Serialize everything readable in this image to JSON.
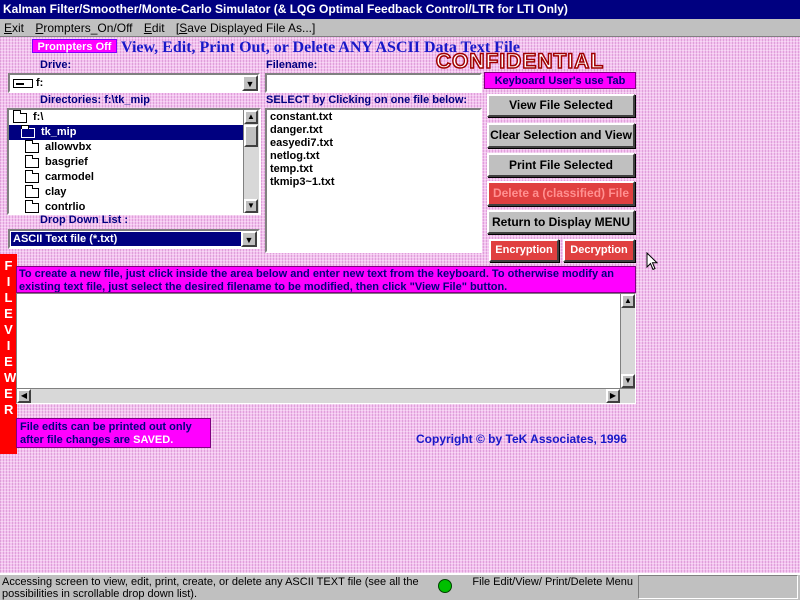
{
  "window": {
    "title": "Kalman Filter/Smoother/Monte-Carlo Simulator (& LQG Optimal Feedback Control/LTR for LTI Only)"
  },
  "menu": {
    "items": [
      "Exit",
      "Prompters_On/Off",
      "Edit",
      "[Save Displayed File As...]"
    ]
  },
  "header": {
    "prompters_badge": "Prompters Off",
    "heading": "View, Edit, Print Out, or Delete ANY ASCII Data Text File",
    "stamp": "CONFIDENTIAL"
  },
  "drive": {
    "label": "Drive:",
    "value": "f:"
  },
  "directories": {
    "label": "Directories: f:\\tk_mip",
    "items": [
      "f:\\",
      "tk_mip",
      "allowvbx",
      "basgrief",
      "carmodel",
      "clay",
      "contrlio"
    ],
    "selected_index": 1
  },
  "filetype": {
    "label": "Drop Down List :",
    "value": "ASCII Text file (*.txt)"
  },
  "filename": {
    "label": "Filename:",
    "value": ""
  },
  "files": {
    "label": "SELECT by Clicking on one file below:",
    "items": [
      "constant.txt",
      "danger.txt",
      "easyedi7.txt",
      "netlog.txt",
      "temp.txt",
      "tkmip3~1.txt"
    ]
  },
  "buttons": {
    "keyboard_hint": "Keyboard User's use Tab",
    "view": "View File Selected",
    "clear": "Clear Selection and View",
    "print": "Print File Selected",
    "delete": "Delete a (classified) File",
    "return": "Return to Display MENU",
    "encryption": "Encryption",
    "decryption": "Decryption"
  },
  "viewer": {
    "side_label": "FILE VIEWER",
    "instructions": "To create a new file, just click inside the area below and enter new text from the keyboard. To otherwise modify an existing text file, just select the desired filename to be modified, then click \"View File\" button.",
    "content": ""
  },
  "note": {
    "line1": "File edits can be printed out only",
    "line2_prefix": "after  file changes are ",
    "line2_emph": "SAVED."
  },
  "copyright": "Copyright © by TeK Associates, 1996",
  "status": {
    "message": "Accessing screen to view, edit, print, create, or delete any ASCII TEXT file (see all the possibilities in scrollable drop down list).",
    "indicator_color": "#00c000",
    "right_text": "File Edit/View/ Print/Delete Menu"
  },
  "colors": {
    "magenta": "#ff00ff",
    "blue_text": "#1818c8",
    "red": "#ff0000",
    "stamp": "#a00000"
  }
}
